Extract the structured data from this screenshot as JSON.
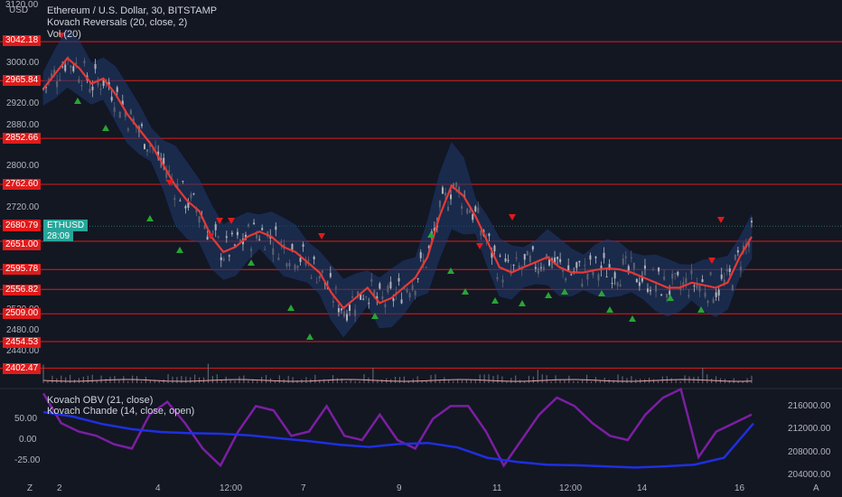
{
  "legend": {
    "title": "Ethereum / U.S. Dollar, 30, BITSTAMP",
    "indicator1": "Kovach Reversals (20, close, 2)",
    "indicator2": "Vol (20)",
    "lower1": "Kovach OBV (21, close)",
    "lower2": "Kovach Chande (14, close, open)"
  },
  "price_axis": {
    "currency": "USD",
    "top_cut": "3120.00",
    "labels": [
      "3000.00",
      "2920.00",
      "2880.00",
      "2800.00",
      "2720.00",
      "2520.00",
      "2480.00",
      "2440.00"
    ]
  },
  "level_tags": [
    "3042.18",
    "2965.84",
    "2852.66",
    "2762.60",
    "2651.00",
    "2595.78",
    "2556.82",
    "2509.00",
    "2454.53",
    "2402.47"
  ],
  "current": {
    "price": "2680.79",
    "ticker": "ETHUSD",
    "countdown": "28:09"
  },
  "lower_left_axis": [
    "50.00",
    "0.00",
    "-25.00"
  ],
  "lower_right_axis": [
    "216000.00",
    "212000.00",
    "208000.00",
    "204000.00"
  ],
  "time_axis": [
    "2",
    "4",
    "12:00",
    "7",
    "9",
    "11",
    "12:00",
    "14",
    "16"
  ],
  "buttons": {
    "left": "Z",
    "right": "A"
  },
  "colors": {
    "background": "#131722",
    "level_line": "#e01b1b",
    "ma_line": "#e53935",
    "band": "#1e3a6e",
    "obv": "#1f2fe0",
    "chande": "#7b1fa2",
    "up_triangle": "#26a634",
    "down_triangle": "#e01b1b"
  },
  "chart_data": {
    "type": "line",
    "series": [
      {
        "values": [
          2950,
          2980,
          3010,
          2990,
          2960,
          2970,
          2940,
          2900,
          2870,
          2840,
          2800,
          2760,
          2730,
          2710,
          2660,
          2630,
          2640,
          2660,
          2670,
          2660,
          2640,
          2630,
          2610,
          2590,
          2550,
          2520,
          2540,
          2560,
          2530,
          2540,
          2560,
          2580,
          2620,
          2700,
          2760,
          2740,
          2700,
          2650,
          2600,
          2590,
          2600,
          2610,
          2620,
          2600,
          2590,
          2590,
          2595,
          2598,
          2596,
          2590,
          2580,
          2570,
          2560,
          2560,
          2570,
          2565,
          2560,
          2570,
          2620,
          2660
        ]
      },
      {
        "values": [
          55,
          20,
          10,
          5,
          -5,
          -10,
          30,
          45,
          20,
          -10,
          -30,
          10,
          40,
          35,
          5,
          10,
          40,
          5,
          0,
          30,
          0,
          -10,
          25,
          40,
          40,
          10,
          -30,
          0,
          30,
          50,
          40,
          20,
          5,
          0,
          30,
          50,
          60,
          -20,
          10,
          20,
          30
        ]
      },
      {
        "values": [
          214900,
          214100,
          212800,
          211900,
          211400,
          211200,
          211100,
          210800,
          210300,
          209800,
          209200,
          208800,
          209300,
          209500,
          208700,
          206900,
          206200,
          205700,
          205600,
          205400,
          205200,
          205400,
          205700,
          206900,
          212900
        ]
      }
    ],
    "ylim": [
      2402,
      3120
    ]
  }
}
